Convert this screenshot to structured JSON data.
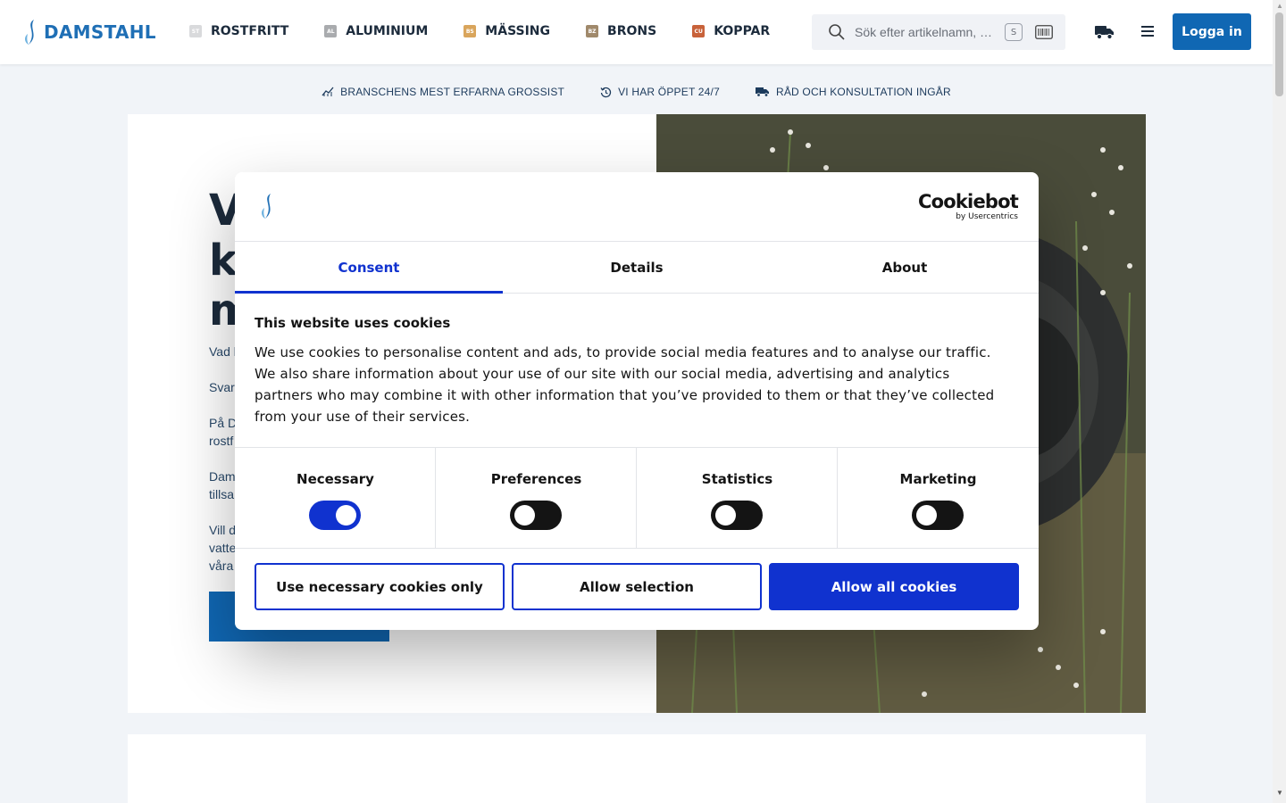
{
  "header": {
    "logo_text": "DAMSTAHL",
    "nav": [
      {
        "label": "ROSTFRITT",
        "badge": "St",
        "color": "#d9dadc"
      },
      {
        "label": "ALUMINIUM",
        "badge": "Al",
        "color": "#a9abae"
      },
      {
        "label": "MÄSSING",
        "badge": "Bs",
        "color": "#d9a55c"
      },
      {
        "label": "BRONS",
        "badge": "Bz",
        "color": "#a0896b"
      },
      {
        "label": "KOPPAR",
        "badge": "Cu",
        "color": "#c8623a"
      }
    ],
    "search_placeholder": "Sök efter artikelnamn, …",
    "search_shortcut": "S",
    "login_label": "Logga in"
  },
  "usps": [
    {
      "icon": "chart-icon",
      "label": "BRANSCHENS MEST ERFARNA GROSSIST"
    },
    {
      "icon": "clock-icon",
      "label": "VI HAR ÖPPET 24/7"
    },
    {
      "icon": "truck-icon",
      "label": "RÅD OCH KONSULTATION INGÅR"
    }
  ],
  "hero": {
    "title": "V\nkı\nm",
    "paragraphs": [
      "Vad l",
      "Svarc",
      "På D\nrostf",
      "Dam\ntillsa",
      "Vill d\nvatte\nvåra"
    ]
  },
  "cookie_dialog": {
    "brand_main": "Cookiebot",
    "brand_sub": "by Usercentrics",
    "tabs": [
      {
        "label": "Consent",
        "active": true
      },
      {
        "label": "Details",
        "active": false
      },
      {
        "label": "About",
        "active": false
      }
    ],
    "title": "This website uses cookies",
    "text": "We use cookies to personalise content and ads, to provide social media features and to analyse our traffic. We also share information about your use of our site with our social media, advertising and analytics partners who may combine it with other information that you’ve provided to them or that they’ve collected from your use of their services.",
    "categories": [
      {
        "label": "Necessary",
        "on": true
      },
      {
        "label": "Preferences",
        "on": false
      },
      {
        "label": "Statistics",
        "on": false
      },
      {
        "label": "Marketing",
        "on": false
      }
    ],
    "buttons": {
      "necessary_only": "Use necessary cookies only",
      "allow_selection": "Allow selection",
      "allow_all": "Allow all cookies"
    }
  },
  "colors": {
    "brand_blue": "#1067b3",
    "cookiebot_blue": "#1032cf"
  }
}
